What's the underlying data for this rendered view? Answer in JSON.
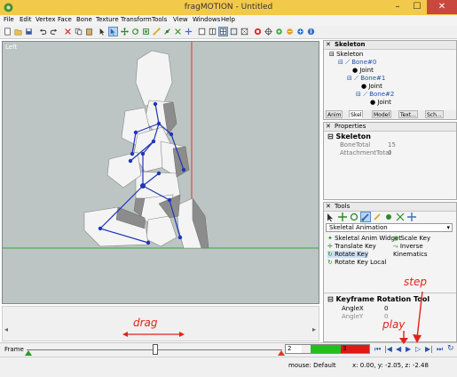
{
  "window": {
    "title": "fragMOTION - Untitled",
    "minimize": "–",
    "maximize": "☐",
    "close": "✕"
  },
  "menu": [
    "File",
    "Edit",
    "Vertex",
    "Face",
    "Bone",
    "Texture",
    "Transform",
    "Tools",
    "View",
    "Windows",
    "Help"
  ],
  "viewport": {
    "label": "Left"
  },
  "skeleton_panel": {
    "title": "Skeleton",
    "tree": [
      "Skeleton",
      "Bone#0",
      "Joint",
      "Bone#1",
      "Joint",
      "Bone#2",
      "Joint"
    ],
    "tabs": [
      "Anim",
      "Skel",
      "Model",
      "Text...",
      "Sch..."
    ]
  },
  "properties_panel": {
    "title": "Properties",
    "section": "Skeleton",
    "rows": [
      {
        "name": "BoneTotal",
        "value": "15"
      },
      {
        "name": "AttachmentTotal",
        "value": "0"
      }
    ]
  },
  "tools_panel": {
    "title": "Tools",
    "mode": "Skeletal Animation",
    "items": [
      "Skeletal Anim Widget",
      "Scale Key",
      "Translate Key",
      "Inverse Kinematics",
      "Rotate Key",
      "Rotate Key Local"
    ],
    "tool_title": "Keyframe Rotation Tool",
    "fields": [
      {
        "name": "AngleX",
        "value": "0"
      },
      {
        "name": "AngleY",
        "value": "0"
      }
    ]
  },
  "timeline": {
    "label": "Frame",
    "frames": [
      "2",
      "3"
    ],
    "play_controls": [
      "first",
      "prev-key",
      "prev",
      "play",
      "next",
      "next-key",
      "last",
      "loop"
    ]
  },
  "status": {
    "mouse": "mouse: Default",
    "coords": "x: 0.00, y: -2.05, z: -2.48"
  },
  "annotations": {
    "drag": "drag",
    "play": "play",
    "step": "step"
  },
  "colors": {
    "titlebar": "#f2c94a",
    "close": "#c9483d",
    "viewport": "#bcc5c3",
    "bone": "#1f35b8",
    "annotation": "#e0241b",
    "key_green": "#20c020",
    "key_red": "#e01818"
  }
}
